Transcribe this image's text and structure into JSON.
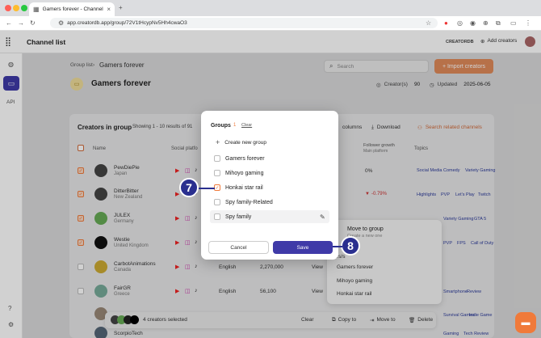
{
  "browser": {
    "tab_title": "Gamers forever - Channel list",
    "url": "app.creatordb.app/group/72V1tHcypNv5Hh4cwaO3"
  },
  "app": {
    "title": "Channel list",
    "brand": "CREATORDB",
    "add_creators": "Add creators",
    "api": "API"
  },
  "page": {
    "breadcrumb_root": "Group list",
    "breadcrumb_current": "Gamers forever",
    "title": "Gamers forever",
    "search_placeholder": "Search",
    "import_label": "+ Import creators",
    "creators_label": "Creator(s)",
    "creators_count": "90",
    "updated_label": "Updated",
    "updated_date": "2025-06-05"
  },
  "table": {
    "heading": "Creators in group",
    "showing": "Showing 1 - 10 results of 91",
    "columns_label": "columns",
    "download_label": "Download",
    "related_label": "Search related channels",
    "col_name": "Name",
    "col_social": "Social platfo",
    "col_growth": "Follower growth",
    "col_growth_sub": "Main platform",
    "col_topics": "Topics",
    "rows": [
      {
        "name": "PewDiePie",
        "country": "Japan",
        "growth": "0%",
        "topics": [
          "Social Media Comedy",
          "Variety Gaming"
        ]
      },
      {
        "name": "DitterBitter",
        "country": "New Zealand",
        "growth": "-0.79%",
        "topics": [
          "Highlights",
          "PVP",
          "Let's Play",
          "Twitch"
        ]
      },
      {
        "name": "JULEX",
        "country": "Germany",
        "growth": "",
        "topics": [
          "Variety Gaming",
          "GTA 5"
        ]
      },
      {
        "name": "Westie",
        "country": "United Kingdom",
        "growth": "",
        "topics": [
          "PVP",
          "FPS",
          "Call of Duty"
        ]
      },
      {
        "name": "CarbotAnimations",
        "country": "Canada",
        "lang": "English",
        "followers": "2,270,000",
        "view": "View",
        "topics": []
      },
      {
        "name": "FairGR",
        "country": "Greece",
        "lang": "English",
        "followers": "56,100",
        "view": "View",
        "topics": [
          "Smartphone",
          "Review"
        ]
      },
      {
        "name": "",
        "country": "",
        "topics": [
          "Survival Games",
          "Indie Game"
        ]
      },
      {
        "name": "ScorpioTech",
        "country": "",
        "topics": [
          "Gaming",
          "Tech Review"
        ]
      }
    ]
  },
  "bulk": {
    "selected": "4 creators selected",
    "clear": "Clear",
    "copy": "Copy to",
    "move": "Move to",
    "delete": "Delete"
  },
  "move_menu": {
    "title": "Move to group",
    "subtitle": "Create a new one",
    "partial": "rs/s",
    "items": [
      "Gamers forever",
      "Mihoyo gaming",
      "Honkai star rail"
    ]
  },
  "modal": {
    "title": "Groups",
    "count": "1",
    "clear": "Clear",
    "create": "Create new group",
    "groups": [
      {
        "name": "Gamers forever",
        "checked": false
      },
      {
        "name": "Mihoyo gaming",
        "checked": false
      },
      {
        "name": "Honkai star rail",
        "checked": true
      },
      {
        "name": "Spy family-Related",
        "checked": false
      },
      {
        "name": "Spy family",
        "checked": false
      }
    ],
    "cancel": "Cancel",
    "save": "Save"
  },
  "steps": {
    "seven": "7",
    "eight": "8"
  },
  "colors": {
    "accent": "#f07a3a",
    "primary": "#3f3aa8",
    "step": "#2a2f8f"
  }
}
